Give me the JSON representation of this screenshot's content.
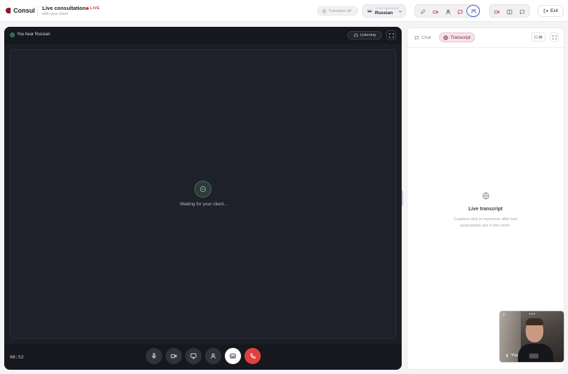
{
  "header": {
    "brand": "Consul",
    "title": "Live consultation",
    "subtitle": "with your client",
    "live_badge": "LIVE",
    "translator_label": "Translator off",
    "language": {
      "caption": "YOUR LANGUAGE",
      "value": "Russian"
    },
    "exit_label": "Exit"
  },
  "video": {
    "hear_text": "You hear Russian",
    "listening_label": "Listening",
    "waiting_text": "Waiting for your client...",
    "timer": "00:52"
  },
  "panel": {
    "tabs": [
      {
        "label": "Chat",
        "active": false
      },
      {
        "label": "Transcript",
        "active": true
      }
    ],
    "empty_title": "Live transcript",
    "empty_desc": "Captions kick in moments after two participants are in the room."
  },
  "self_view": {
    "label": "You"
  },
  "colors": {
    "accent_blue": "#3a63c9",
    "live_red": "#e0353f",
    "end_call_red": "#e2403f",
    "transcript_tab_bg": "#f6e3ea",
    "video_bg": "#1c1e25"
  },
  "icons": [
    "globe-icon",
    "headphones-icon",
    "expand-icon",
    "mic-icon",
    "camera-icon",
    "screen-share-icon",
    "person-icon",
    "captions-icon",
    "phone-end-icon",
    "chat-bubble-icon",
    "log-out-icon",
    "chevron-down-icon",
    "sliders-icon",
    "pen-icon",
    "layout-icon"
  ]
}
